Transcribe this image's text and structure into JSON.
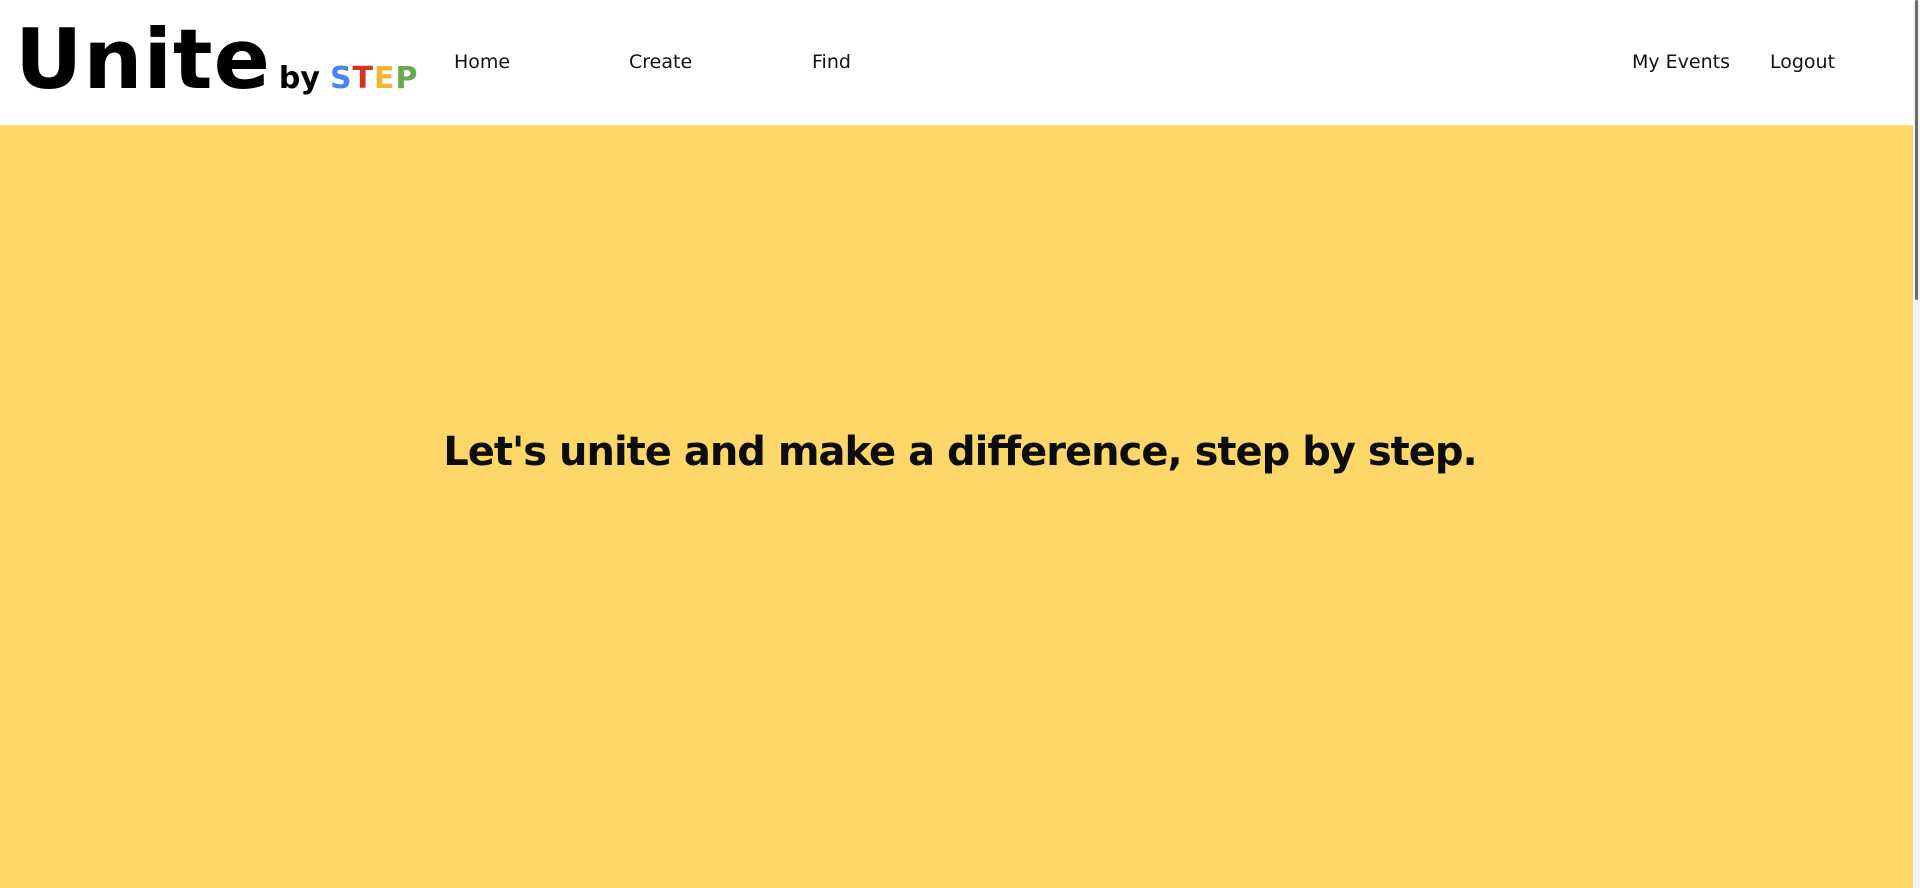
{
  "header": {
    "logo": {
      "main": "Unite",
      "by": "by",
      "step_letters": [
        {
          "char": "S",
          "color": "#4a86e8"
        },
        {
          "char": "T",
          "color": "#d93025"
        },
        {
          "char": "E",
          "color": "#f2b632"
        },
        {
          "char": "P",
          "color": "#6aa84f"
        }
      ]
    },
    "nav": {
      "home": "Home",
      "create": "Create",
      "find": "Find",
      "my_events": "My Events",
      "logout": "Logout"
    }
  },
  "hero": {
    "tagline": "Let's unite and make a difference, step by step.",
    "background_color": "#fdd868"
  }
}
